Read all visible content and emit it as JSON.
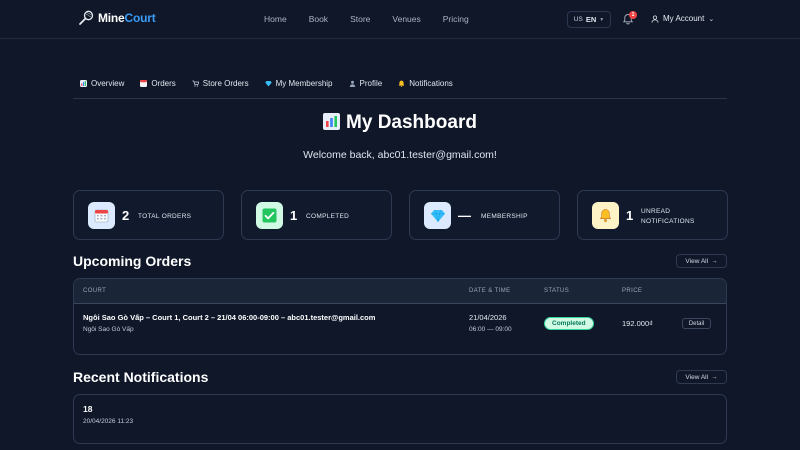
{
  "brand": {
    "name_part1": "Mine",
    "name_part2": "Court"
  },
  "nav": [
    "Home",
    "Book",
    "Store",
    "Venues",
    "Pricing"
  ],
  "language": {
    "flag": "US",
    "code": "EN"
  },
  "notifications_badge": "1",
  "account_label": "My Account",
  "tabs": [
    {
      "label": "Overview",
      "icon": "chart-icon"
    },
    {
      "label": "Orders",
      "icon": "calendar-icon"
    },
    {
      "label": "Store Orders",
      "icon": "cart-icon"
    },
    {
      "label": "My Membership",
      "icon": "diamond-icon"
    },
    {
      "label": "Profile",
      "icon": "user-icon"
    },
    {
      "label": "Notifications",
      "icon": "bell-icon"
    }
  ],
  "page": {
    "title": "My Dashboard",
    "welcome": "Welcome back, abc01.tester@gmail.com!"
  },
  "stats": [
    {
      "value": "2",
      "label": "TOTAL ORDERS",
      "icon": "calendar-icon"
    },
    {
      "value": "1",
      "label": "COMPLETED",
      "icon": "check-icon"
    },
    {
      "value": "—",
      "label": "MEMBERSHIP",
      "icon": "diamond-icon"
    },
    {
      "value": "1",
      "label_line1": "UNREAD",
      "label_line2": "NOTIFICATIONS",
      "icon": "bell-icon"
    }
  ],
  "upcoming": {
    "title": "Upcoming Orders",
    "view_all": "View All",
    "columns": [
      "COURT",
      "DATE & TIME",
      "STATUS",
      "PRICE"
    ],
    "rows": [
      {
        "court": "Ngôi Sao Gò Vấp – Court 1, Court 2 – 21/04 06:00-09:00 – abc01.tester@gmail.com",
        "venue": "Ngôi Sao Gò Vấp",
        "date": "21/04/2026",
        "time": "06:00 — 09:00",
        "status": "Completed",
        "price": "192.000₫",
        "action": "Detail"
      }
    ]
  },
  "notifications": {
    "title": "Recent Notifications",
    "view_all": "View All",
    "items": [
      {
        "title": "18",
        "time": "20/04/2026 11:23"
      }
    ]
  },
  "colors": {
    "background": "#0f1729",
    "accent": "#3b9cf6",
    "status_bg": "#d1fae5",
    "status_text": "#047857",
    "badge": "#ef4444"
  }
}
